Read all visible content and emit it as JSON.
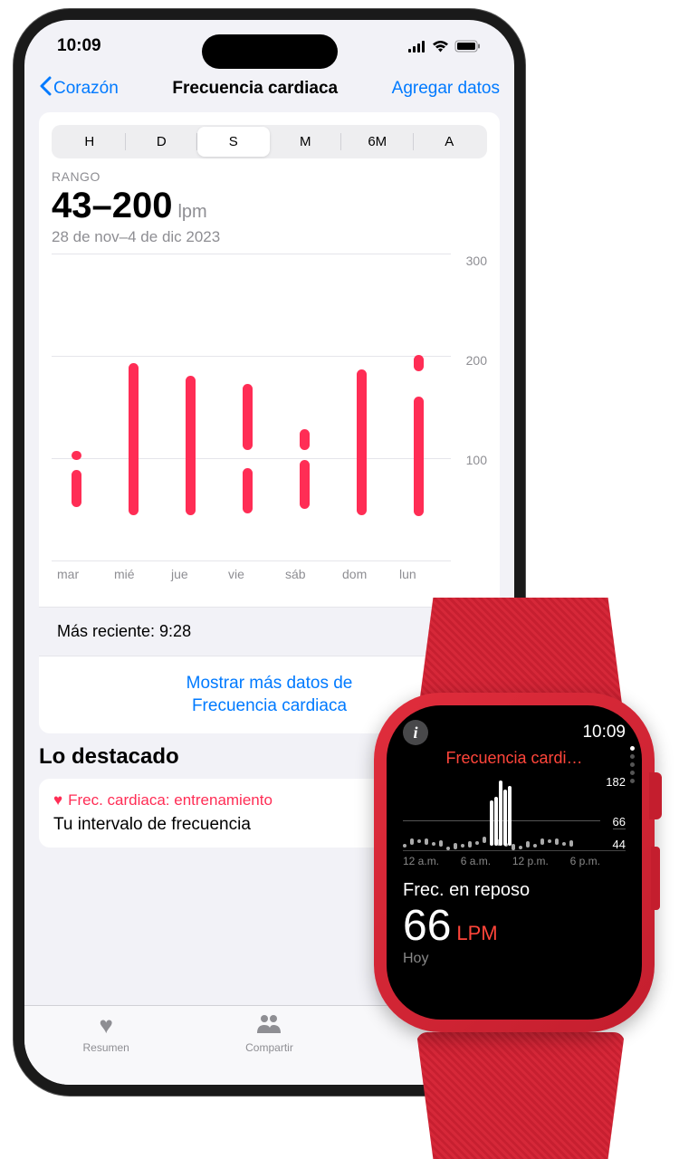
{
  "iphone": {
    "status": {
      "time": "10:09"
    },
    "nav": {
      "back": "Corazón",
      "title": "Frecuencia cardiaca",
      "action": "Agregar datos"
    },
    "segments": [
      "H",
      "D",
      "S",
      "M",
      "6M",
      "A"
    ],
    "active_segment": 2,
    "range": {
      "label": "RANGO",
      "value": "43–200",
      "unit": "lpm",
      "date": "28 de nov–4 de dic 2023"
    },
    "recent": {
      "text": "Más reciente: 9:28"
    },
    "more_link": "Mostrar más datos de\nFrecuencia cardiaca",
    "highlights": {
      "title": "Lo destacado",
      "card": {
        "label": "Frec. cardiaca: entrenamiento",
        "text": "Tu intervalo de frecuencia"
      }
    },
    "tabs": [
      {
        "label": "Resumen"
      },
      {
        "label": "Compartir"
      }
    ]
  },
  "watch": {
    "time": "10:09",
    "title": "Frecuencia cardi…",
    "y_labels": {
      "top": "182",
      "mid": "66",
      "bot": "44"
    },
    "x_labels": [
      "12 a.m.",
      "6 a.m.",
      "12 p.m.",
      "6 p.m."
    ],
    "metric_label": "Frec. en reposo",
    "metric_value": "66",
    "metric_unit": "LPM",
    "date": "Hoy"
  },
  "chart_data": {
    "type": "bar",
    "title": "Frecuencia cardiaca",
    "ylabel": "lpm",
    "ylim": [
      0,
      300
    ],
    "categories": [
      "mar",
      "mié",
      "jue",
      "vie",
      "sáb",
      "dom",
      "lun"
    ],
    "series": [
      {
        "name": "rango",
        "segments": [
          [
            [
              52,
              88
            ],
            [
              98,
              102
            ]
          ],
          [
            [
              44,
              192
            ]
          ],
          [
            [
              44,
              180
            ]
          ],
          [
            [
              46,
              90
            ],
            [
              108,
              172
            ]
          ],
          [
            [
              50,
              98
            ],
            [
              108,
              128
            ]
          ],
          [
            [
              44,
              186
            ]
          ],
          [
            [
              43,
              160
            ],
            [
              184,
              200
            ]
          ]
        ]
      }
    ]
  }
}
